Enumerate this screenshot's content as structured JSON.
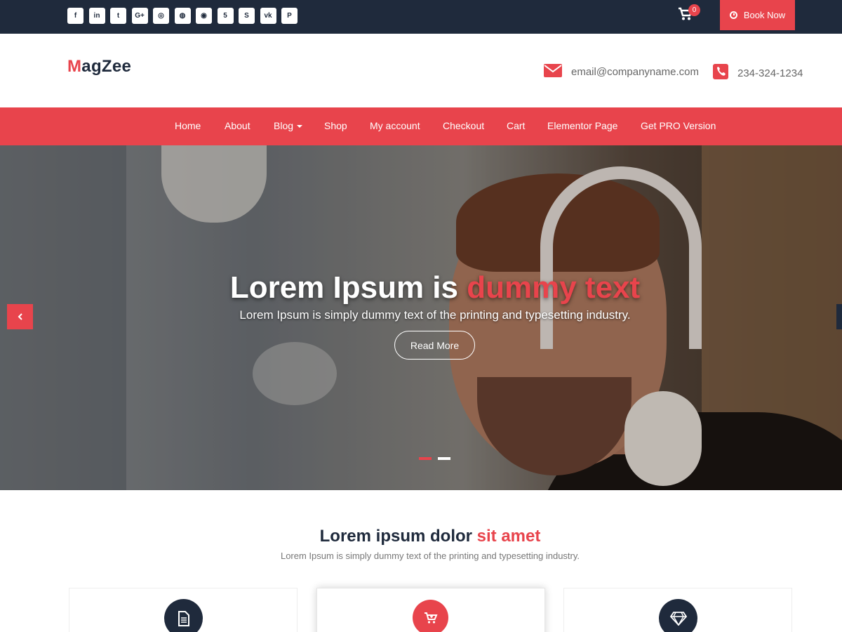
{
  "topbar": {
    "social": [
      {
        "name": "facebook-icon",
        "glyph": "f"
      },
      {
        "name": "linkedin-icon",
        "glyph": "in"
      },
      {
        "name": "twitter-icon",
        "glyph": "t"
      },
      {
        "name": "google-plus-icon",
        "glyph": "G+"
      },
      {
        "name": "instagram-icon",
        "glyph": "◎"
      },
      {
        "name": "dribbble-icon",
        "glyph": "◍"
      },
      {
        "name": "github-icon",
        "glyph": "◉"
      },
      {
        "name": "html5-icon",
        "glyph": "5"
      },
      {
        "name": "skype-icon",
        "glyph": "S"
      },
      {
        "name": "vk-icon",
        "glyph": "vk"
      },
      {
        "name": "pinterest-icon",
        "glyph": "P"
      }
    ],
    "cart_count": "0",
    "book_label": "Book Now"
  },
  "header": {
    "logo_first": "M",
    "logo_rest": "agZee",
    "email": "email@companyname.com",
    "phone": "234-324-1234"
  },
  "nav": {
    "items": [
      "Home",
      "About",
      "Blog",
      "Shop",
      "My account",
      "Checkout",
      "Cart",
      "Elementor Page",
      "Get PRO Version"
    ]
  },
  "hero": {
    "title_white": "Lorem Ipsum is ",
    "title_red": "dummy text",
    "subtitle": "Lorem Ipsum is simply dummy text of the printing and typesetting industry.",
    "button": "Read More",
    "slides": 2,
    "active_slide": 1
  },
  "section": {
    "title_dark": "Lorem ipsum dolor ",
    "title_red": "sit amet",
    "subtitle": "Lorem Ipsum is simply dummy text of the printing and typesetting industry.",
    "cards": [
      {
        "icon": "document-icon"
      },
      {
        "icon": "cart-plus-icon"
      },
      {
        "icon": "diamond-icon"
      }
    ]
  },
  "colors": {
    "accent": "#e8444c",
    "dark": "#1f2a3c"
  }
}
